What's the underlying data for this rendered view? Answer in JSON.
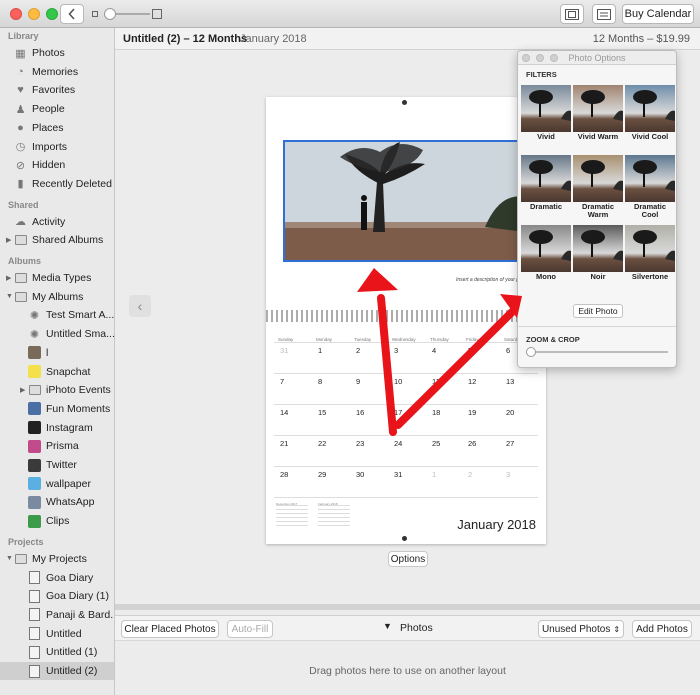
{
  "toolbar": {
    "buy_label": "Buy Calendar"
  },
  "sidebar": {
    "sections": [
      {
        "label": "Library",
        "items": [
          {
            "label": "Photos",
            "icon": "photos-icon"
          },
          {
            "label": "Memories",
            "icon": "memories-icon"
          },
          {
            "label": "Favorites",
            "icon": "heart-icon"
          },
          {
            "label": "People",
            "icon": "person-icon"
          },
          {
            "label": "Places",
            "icon": "pin-icon"
          },
          {
            "label": "Imports",
            "icon": "clock-icon"
          },
          {
            "label": "Hidden",
            "icon": "eye-slash-icon"
          },
          {
            "label": "Recently Deleted",
            "icon": "trash-icon"
          }
        ]
      },
      {
        "label": "Shared",
        "items": [
          {
            "label": "Activity",
            "icon": "cloud-icon"
          },
          {
            "label": "Shared Albums",
            "icon": "folder-icon"
          }
        ]
      },
      {
        "label": "Albums",
        "items": [
          {
            "label": "Media Types",
            "icon": "folder-icon"
          },
          {
            "label": "My Albums",
            "icon": "folder-icon"
          },
          {
            "label": "Test Smart A...",
            "icon": "gear-icon"
          },
          {
            "label": "Untitled Sma...",
            "icon": "gear-icon"
          },
          {
            "label": "l",
            "icon": "album-icon"
          },
          {
            "label": "Snapchat",
            "icon": "album-icon"
          },
          {
            "label": "iPhoto Events",
            "icon": "folder-icon"
          },
          {
            "label": "Fun Moments",
            "icon": "album-icon"
          },
          {
            "label": "Instagram",
            "icon": "album-icon"
          },
          {
            "label": "Prisma",
            "icon": "album-icon"
          },
          {
            "label": "Twitter",
            "icon": "album-icon"
          },
          {
            "label": "wallpaper",
            "icon": "album-icon"
          },
          {
            "label": "WhatsApp",
            "icon": "album-icon"
          },
          {
            "label": "Clips",
            "icon": "album-icon"
          }
        ]
      },
      {
        "label": "Projects",
        "items": [
          {
            "label": "My Projects",
            "icon": "folder-icon"
          },
          {
            "label": "Goa Diary",
            "icon": "project-icon"
          },
          {
            "label": "Goa Diary (1)",
            "icon": "project-icon"
          },
          {
            "label": "Panaji & Bard...",
            "icon": "project-icon"
          },
          {
            "label": "Untitled",
            "icon": "project-icon"
          },
          {
            "label": "Untitled (1)",
            "icon": "project-icon"
          },
          {
            "label": "Untitled (2)",
            "icon": "project-icon"
          }
        ]
      }
    ]
  },
  "header": {
    "project_title": "Untitled (2) – 12 Months",
    "month": "January 2018",
    "price": "12 Months – $19.99"
  },
  "calendar": {
    "caption": "Insert a description of your photo",
    "weekdays": [
      "Sunday",
      "Monday",
      "Tuesday",
      "Wednesday",
      "Thursday",
      "Friday",
      "Saturday"
    ],
    "weeks": [
      [
        "31",
        "1",
        "2",
        "3",
        "4",
        "5",
        "6"
      ],
      [
        "7",
        "8",
        "9",
        "10",
        "11",
        "12",
        "13"
      ],
      [
        "14",
        "15",
        "16",
        "17",
        "18",
        "19",
        "20"
      ],
      [
        "21",
        "22",
        "23",
        "24",
        "25",
        "26",
        "27"
      ],
      [
        "28",
        "29",
        "30",
        "31",
        "1",
        "2",
        "3"
      ]
    ],
    "mini_labels": [
      "December 2017",
      "February 2018"
    ],
    "month_label": "January 2018",
    "options_label": "Options"
  },
  "bottom": {
    "clear_label": "Clear Placed Photos",
    "autofill_label": "Auto-Fill",
    "photos_label": "Photos",
    "unused_label": "Unused Photos",
    "add_label": "Add Photos",
    "drag_text": "Drag photos here to use on another layout"
  },
  "panel": {
    "title": "Photo Options",
    "filters_label": "FILTERS",
    "filters": [
      {
        "name": "Vivid",
        "tint": "#7a8a9a"
      },
      {
        "name": "Vivid Warm",
        "tint": "#a08470"
      },
      {
        "name": "Vivid Cool",
        "tint": "#6f8eaa"
      },
      {
        "name": "Dramatic",
        "tint": "#667788"
      },
      {
        "name": "Dramatic Warm",
        "tint": "#a89070"
      },
      {
        "name": "Dramatic Cool",
        "tint": "#5d7890"
      },
      {
        "name": "Mono",
        "tint": "#888888"
      },
      {
        "name": "Noir",
        "tint": "#5a5a5a"
      },
      {
        "name": "Silvertone",
        "tint": "#b0b0a8"
      }
    ],
    "edit_label": "Edit Photo",
    "zoom_label": "ZOOM & CROP"
  },
  "colors": {
    "selection": "#2f6fd8",
    "arrow": "#e8141a"
  }
}
